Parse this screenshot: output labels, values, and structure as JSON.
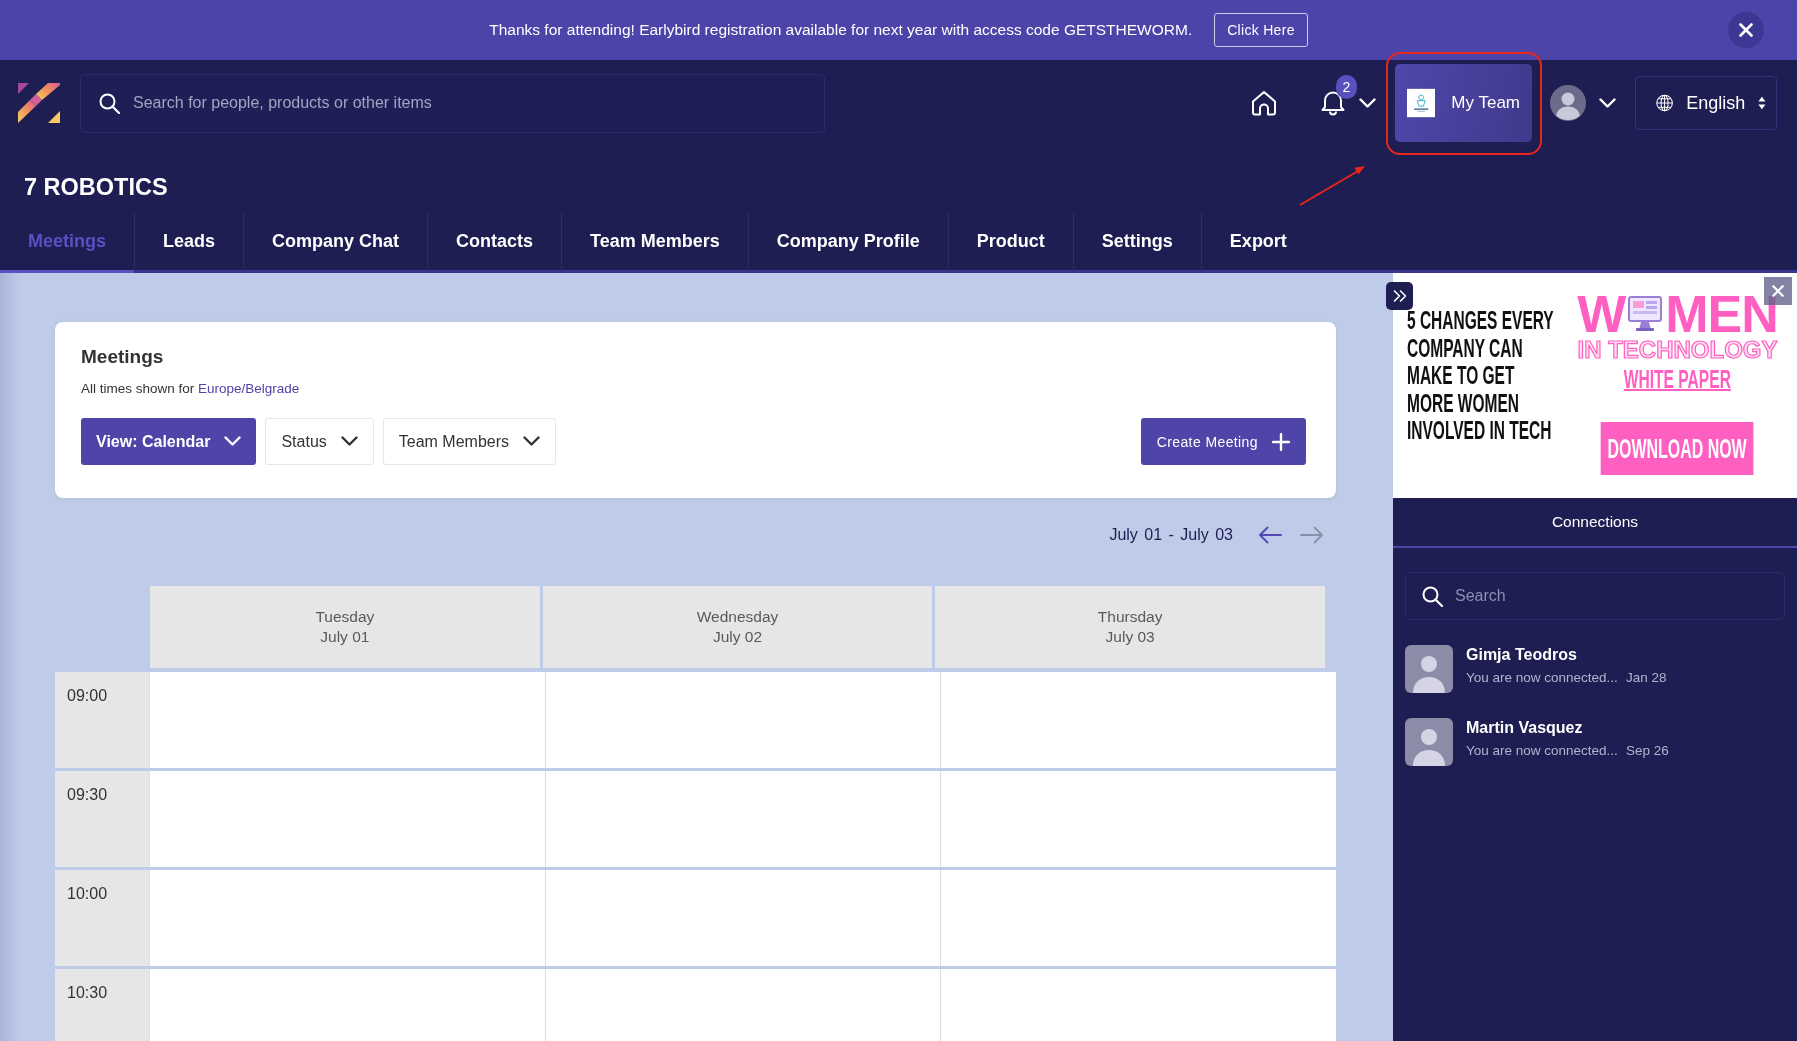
{
  "announcement": {
    "message": "Thanks for attending! Earlybird registration available for next year with access code GETSTHEWORM.",
    "button": "Click Here"
  },
  "header": {
    "search": {
      "placeholder": "Search for people, products or other items"
    },
    "notifications": {
      "count": "2"
    },
    "my_team": {
      "label": "My Team",
      "annotated": true
    },
    "language": {
      "value": "English"
    }
  },
  "company": {
    "name": "7 ROBOTICS"
  },
  "tabs": [
    {
      "label": "Meetings",
      "selected": true
    },
    {
      "label": "Leads",
      "selected": false
    },
    {
      "label": "Company Chat",
      "selected": false
    },
    {
      "label": "Contacts",
      "selected": false
    },
    {
      "label": "Team Members",
      "selected": false
    },
    {
      "label": "Company Profile",
      "selected": false
    },
    {
      "label": "Product",
      "selected": false
    },
    {
      "label": "Settings",
      "selected": false
    },
    {
      "label": "Export",
      "selected": false
    }
  ],
  "meetings": {
    "title": "Meetings",
    "timezone_prefix": "All times shown for",
    "timezone": "Europe/Belgrade",
    "filters": [
      {
        "label": "View: Calendar",
        "kind": "primary"
      },
      {
        "label": "Status",
        "kind": "dropdown"
      },
      {
        "label": "Team Members",
        "kind": "dropdown"
      }
    ],
    "create_button": "Create Meeting"
  },
  "calendar": {
    "range": "July 01 - July 03",
    "nav": [
      {
        "kind": "prev",
        "disabled": false
      },
      {
        "kind": "next",
        "disabled": true
      }
    ],
    "days": [
      {
        "weekday": "Tuesday",
        "date": "July 01"
      },
      {
        "weekday": "Wednesday",
        "date": "July 02"
      },
      {
        "weekday": "Thursday",
        "date": "July 03"
      }
    ],
    "times": [
      "09:00",
      "09:30",
      "10:00",
      "10:30"
    ]
  },
  "sidebar": {
    "ad": {
      "headline": "5 CHANGES EVERY COMPANY CAN MAKE TO GET MORE WOMEN INVOLVED IN TECH",
      "title_start": "W",
      "title_end": "MEN",
      "subtitle": "IN TECHNOLOGY",
      "link": "WHITE PAPER",
      "button": "DOWNLOAD NOW"
    },
    "connections": {
      "title": "Connections",
      "search": {
        "placeholder": "Search"
      },
      "items": [
        {
          "name": "Gimja Teodros",
          "message": "You are now connected...",
          "date": "Jan 28"
        },
        {
          "name": "Martin Vasquez",
          "message": "You are now connected...",
          "date": "Sep 26"
        }
      ]
    }
  }
}
